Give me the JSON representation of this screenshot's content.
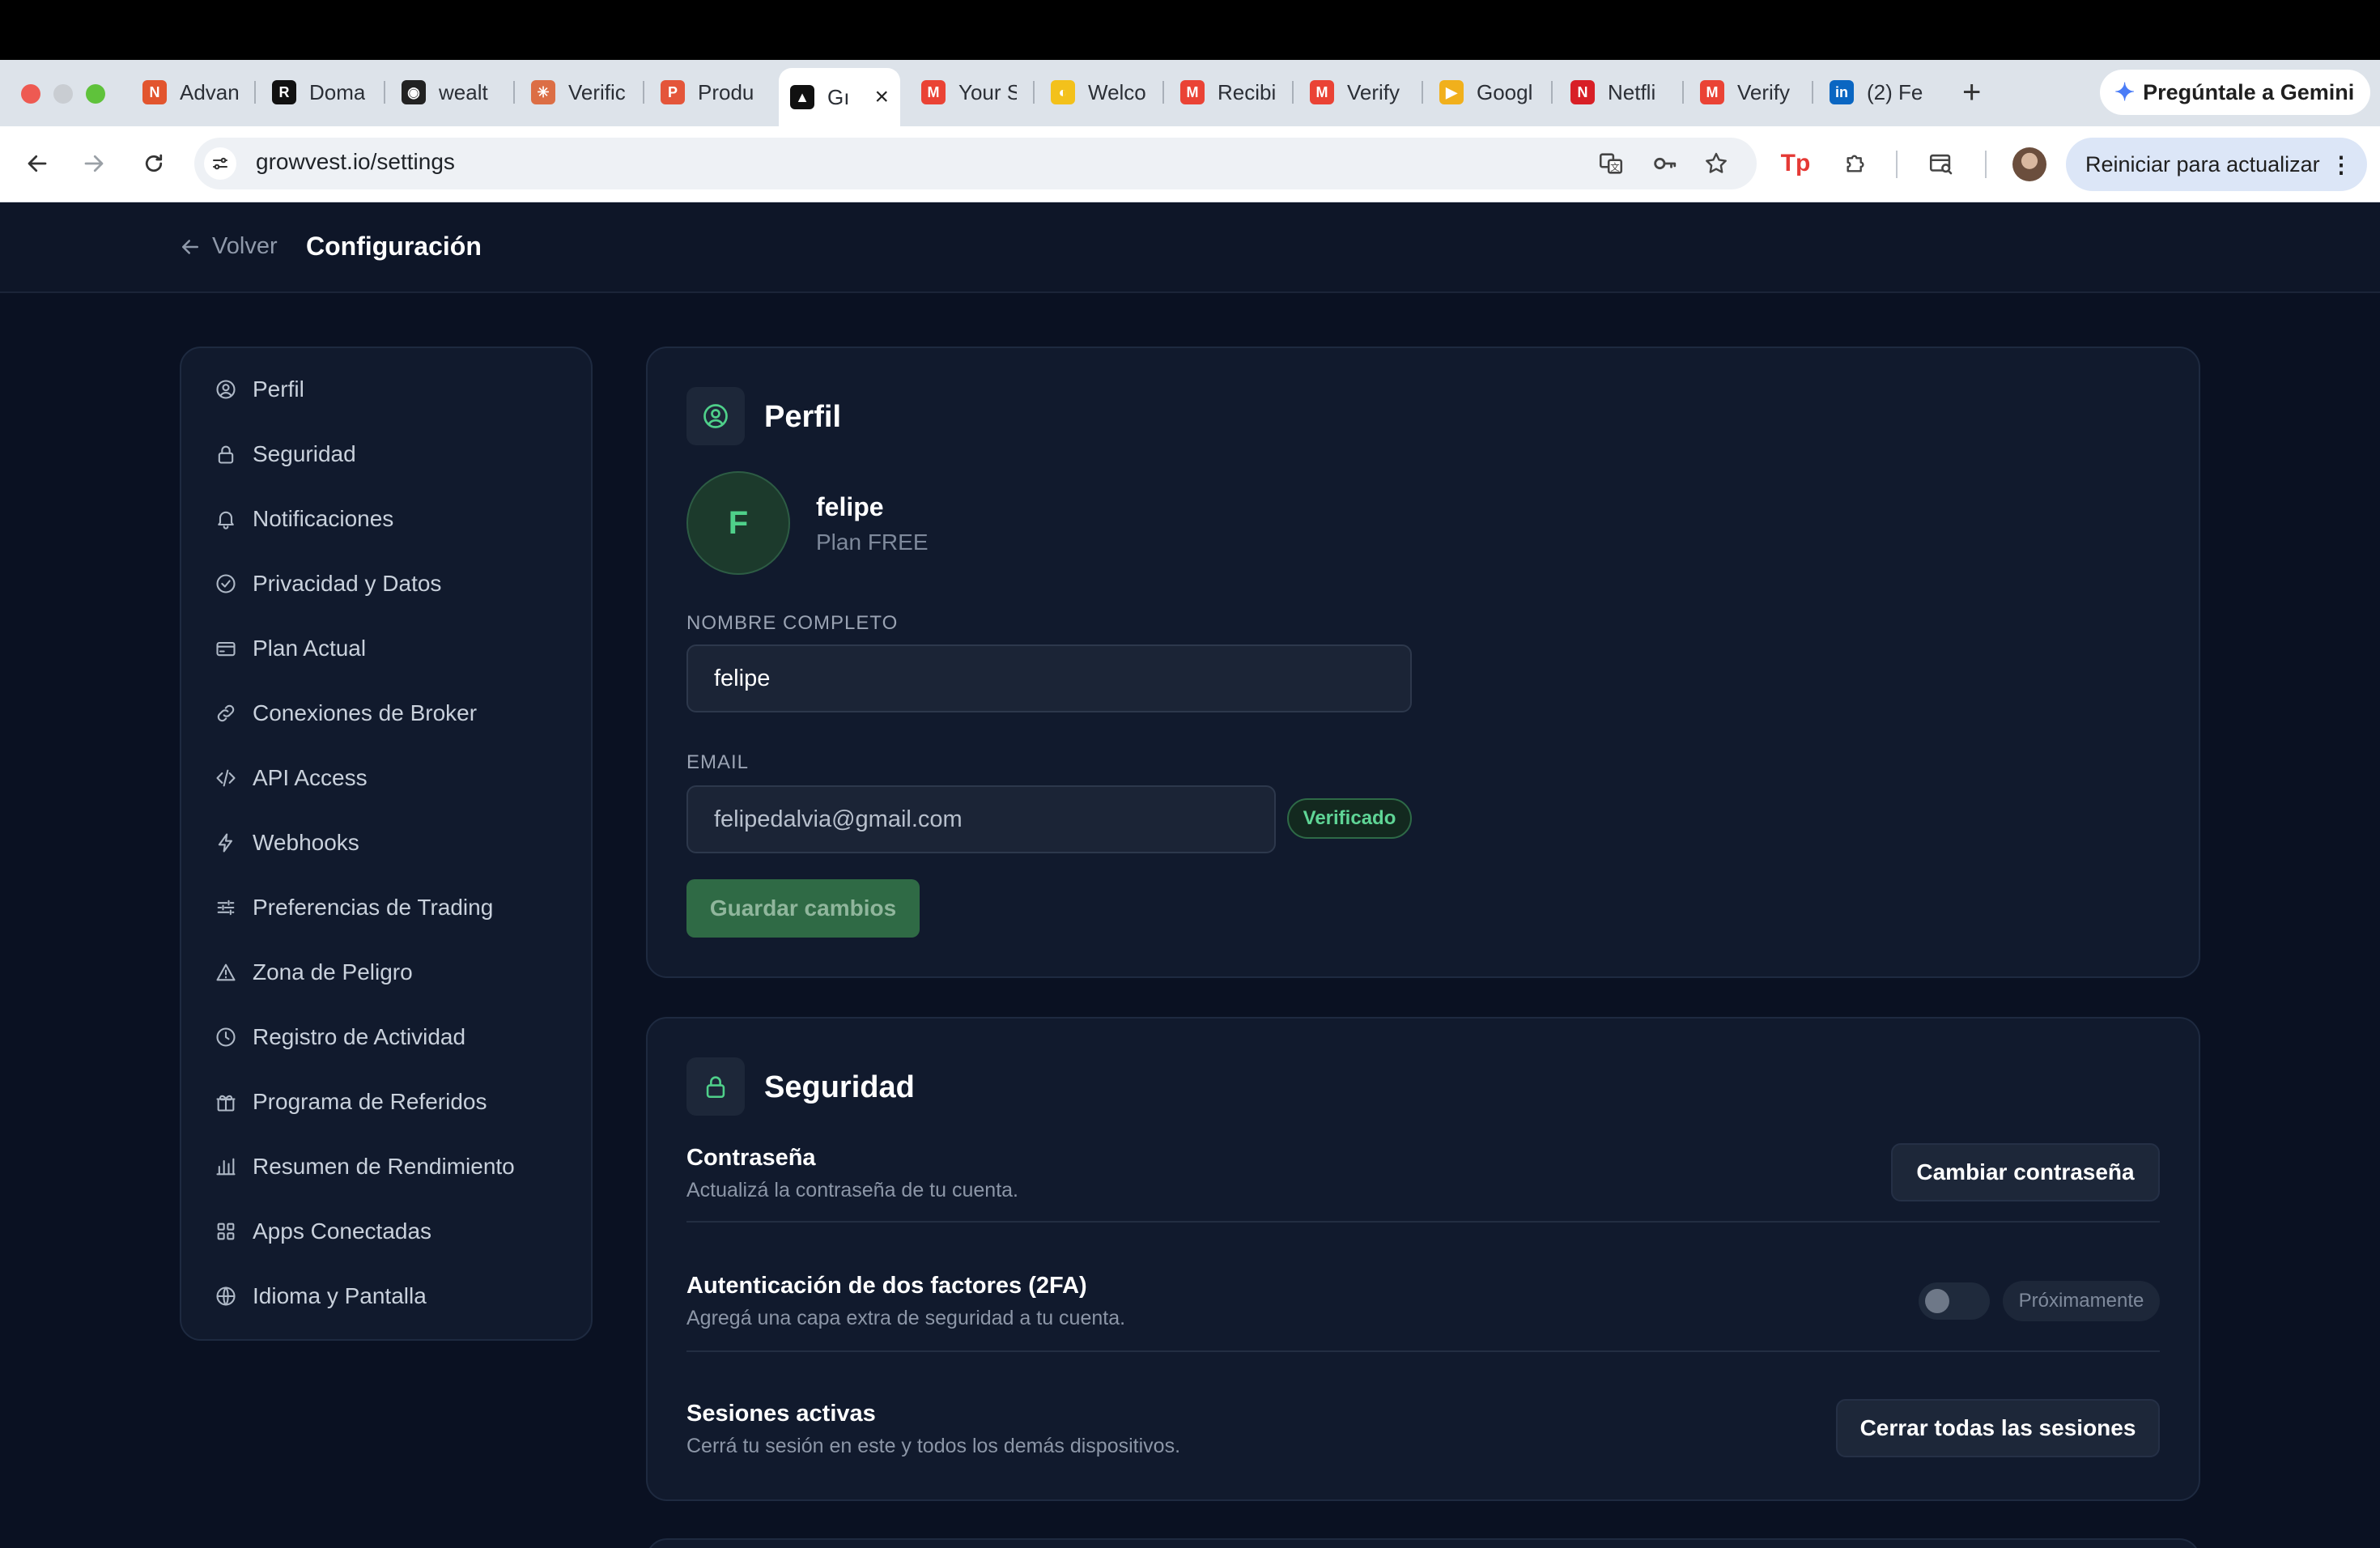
{
  "browser": {
    "tabs": [
      {
        "title": "Advan",
        "fav_color": "#e2552e",
        "fav_glyph": "N"
      },
      {
        "title": "Doma",
        "fav_color": "#111111",
        "fav_glyph": "R"
      },
      {
        "title": "wealt",
        "fav_color": "#222222",
        "fav_glyph": "◉"
      },
      {
        "title": "Verific",
        "fav_color": "#dc6e45",
        "fav_glyph": "✳"
      },
      {
        "title": "Produ",
        "fav_color": "#e4553a",
        "fav_glyph": "P"
      },
      {
        "title": "Gı",
        "fav_color": "#111111",
        "fav_glyph": "▲"
      },
      {
        "title": "Your S",
        "fav_color": "#ea4335",
        "fav_glyph": "M"
      },
      {
        "title": "Welco",
        "fav_color": "#f3c11b",
        "fav_glyph": "◐"
      },
      {
        "title": "Recibi",
        "fav_color": "#ea4335",
        "fav_glyph": "M"
      },
      {
        "title": "Verify",
        "fav_color": "#ea4335",
        "fav_glyph": "M"
      },
      {
        "title": "Googl",
        "fav_color": "#f1b01c",
        "fav_glyph": "▶"
      },
      {
        "title": "Netfli",
        "fav_color": "#d81f26",
        "fav_glyph": "N"
      },
      {
        "title": "Verify",
        "fav_color": "#ea4335",
        "fav_glyph": "M"
      },
      {
        "title": "(2) Fe",
        "fav_color": "#0a66c2",
        "fav_glyph": "in"
      }
    ],
    "gemini_label": "Pregúntale a Gemini",
    "url": "growvest.io/settings",
    "restart_label": "Reiniciar para actualizar"
  },
  "header": {
    "back_label": "Volver",
    "title": "Configuración"
  },
  "sidebar": {
    "items": [
      {
        "label": "Perfil",
        "icon": "user-circle-icon"
      },
      {
        "label": "Seguridad",
        "icon": "lock-icon"
      },
      {
        "label": "Notificaciones",
        "icon": "bell-icon"
      },
      {
        "label": "Privacidad y Datos",
        "icon": "check-circle-icon"
      },
      {
        "label": "Plan Actual",
        "icon": "credit-card-icon"
      },
      {
        "label": "Conexiones de Broker",
        "icon": "link-icon"
      },
      {
        "label": "API Access",
        "icon": "code-icon"
      },
      {
        "label": "Webhooks",
        "icon": "bolt-icon"
      },
      {
        "label": "Preferencias de Trading",
        "icon": "sliders-icon"
      },
      {
        "label": "Zona de Peligro",
        "icon": "warning-icon"
      },
      {
        "label": "Registro de Actividad",
        "icon": "clock-icon"
      },
      {
        "label": "Programa de Referidos",
        "icon": "gift-icon"
      },
      {
        "label": "Resumen de Rendimiento",
        "icon": "bar-chart-icon"
      },
      {
        "label": "Apps Conectadas",
        "icon": "grid-icon"
      },
      {
        "label": "Idioma y Pantalla",
        "icon": "globe-icon"
      }
    ]
  },
  "profile": {
    "title": "Perfil",
    "avatar_letter": "F",
    "username": "felipe",
    "plan": "Plan FREE",
    "name_label": "NOMBRE COMPLETO",
    "name_value": "felipe",
    "email_label": "EMAIL",
    "email_value": "felipedalvia@gmail.com",
    "verified_badge": "Verificado",
    "save_label": "Guardar cambios"
  },
  "security": {
    "title": "Seguridad",
    "password_title": "Contraseña",
    "password_desc": "Actualizá la contraseña de tu cuenta.",
    "password_button": "Cambiar contraseña",
    "twofa_title": "Autenticación de dos factores (2FA)",
    "twofa_desc": "Agregá una capa extra de seguridad a tu cuenta.",
    "twofa_badge": "Próximamente",
    "twofa_enabled": false,
    "sessions_title": "Sesiones activas",
    "sessions_desc": "Cerrá tu sesión en este y todos los demás dispositivos.",
    "sessions_button": "Cerrar todas las sesiones"
  },
  "colors": {
    "accent_green": "#4fd08a",
    "save_button_bg": "#2f6a45",
    "page_bg": "#0a1122",
    "card_bg": "#111a2d"
  }
}
